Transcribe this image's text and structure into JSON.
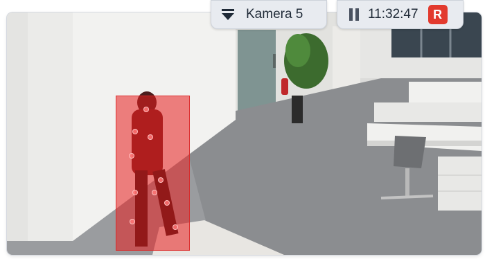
{
  "camera": {
    "label": "Kamera 5",
    "dropdown_icon": "triangle-down-icon"
  },
  "playback": {
    "state_icon": "pause-icon",
    "time": "11:32:47",
    "recording_badge": "R",
    "recording_color": "#e23a2e"
  },
  "detection": {
    "highlight_color": "#e81e1e"
  }
}
